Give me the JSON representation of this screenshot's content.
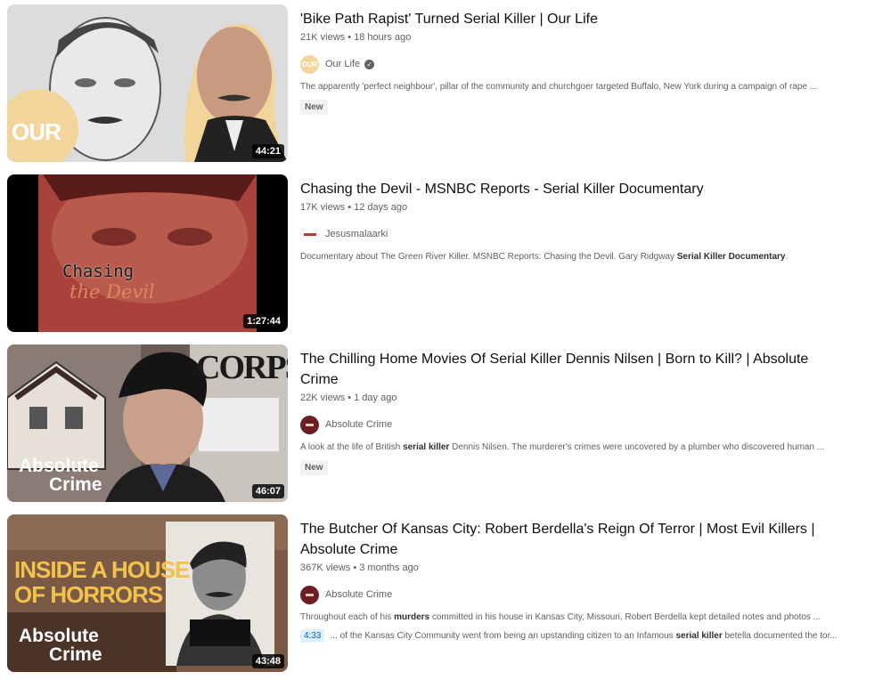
{
  "videos": [
    {
      "title": "'Bike Path Rapist' Turned Serial Killer | Our Life",
      "views": "21K views",
      "age": "18 hours ago",
      "channel": "Our Life",
      "verified": true,
      "avatar_text": "OUR",
      "duration": "44:21",
      "thumb_text": "OUR",
      "description": "The apparently 'perfect neighbour', pillar of the community and churchgoer targeted Buffalo, New York during a campaign of rape ...",
      "badge": "New"
    },
    {
      "title": "Chasing the Devil - MSNBC Reports - Serial Killer Documentary",
      "views": "17K views",
      "age": "12 days ago",
      "channel": "Jesusmalaarki",
      "duration": "1:27:44",
      "thumb_text_1": "Chasing",
      "thumb_text_2": "the Devil",
      "description_pre": "Documentary about The Green River Killer. MSNBC Reports: Chasing the Devil. Gary Ridgway ",
      "description_bold": "Serial Killer Documentary",
      "description_post": "."
    },
    {
      "title": "The Chilling Home Movies Of Serial Killer Dennis Nilsen | Born to Kill? | Absolute Crime",
      "views": "22K views",
      "age": "1 day ago",
      "channel": "Absolute Crime",
      "duration": "46:07",
      "thumb_text_1": "Absolute",
      "thumb_text_2": "Crime",
      "thumb_text_3": "CORPS",
      "description_pre": "A look at the life of British ",
      "description_bold": "serial killer",
      "description_post": " Dennis Nilsen. The murderer's crimes were uncovered by a plumber who discovered human ...",
      "badge": "New"
    },
    {
      "title": "The Butcher Of Kansas City: Robert Berdella's Reign Of Terror | Most Evil Killers | Absolute Crime",
      "views": "367K views",
      "age": "3 months ago",
      "channel": "Absolute Crime",
      "duration": "43:48",
      "thumb_text_1": "INSIDE A HOUSE",
      "thumb_text_2": "OF HORRORS",
      "thumb_text_3": "Absolute",
      "thumb_text_4": "Crime",
      "description_pre": "Throughout each of his ",
      "description_bold": "murders",
      "description_post": " committed in his house in Kansas City, Missouri, Robert Berdella kept detailed notes and photos ...",
      "chapter_time": "4:33",
      "chapter_pre": "... of the Kansas City Community went from being an upstanding citizen to an Infamous ",
      "chapter_bold": "serial killer",
      "chapter_post": " betella documented the tor..."
    }
  ],
  "colors": {
    "our_life_yellow": "#f1d59b",
    "absolute_crime_maroon": "#6b1e24",
    "chapter_blue": "#065fd4"
  }
}
